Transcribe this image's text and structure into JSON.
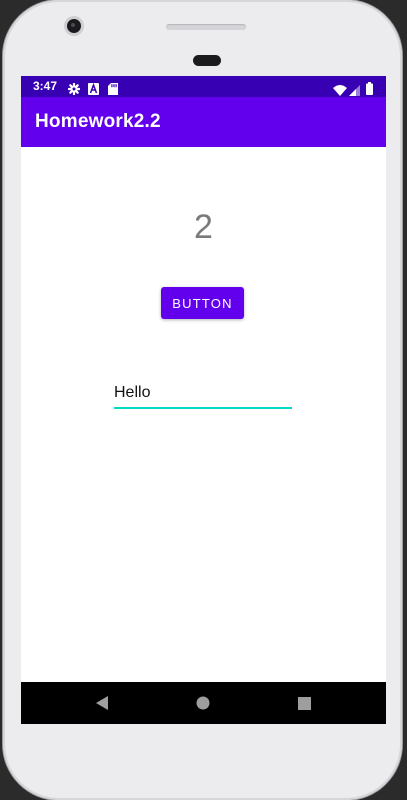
{
  "status_bar": {
    "time": "3:47",
    "icons": [
      "settings-icon",
      "a-icon",
      "sd-card-icon",
      "wifi-icon",
      "signal-icon",
      "battery-icon"
    ]
  },
  "app_bar": {
    "title": "Homework2.2"
  },
  "main": {
    "counter_value": "2",
    "button_label": "BUTTON",
    "text_field_value": "Hello"
  },
  "nav_bar": {
    "buttons": [
      "back-icon",
      "home-icon",
      "recents-icon"
    ]
  },
  "colors": {
    "status_bar": "#3700b3",
    "app_bar": "#6200ee",
    "accent": "#03dac5",
    "nav_bar": "#000000"
  }
}
